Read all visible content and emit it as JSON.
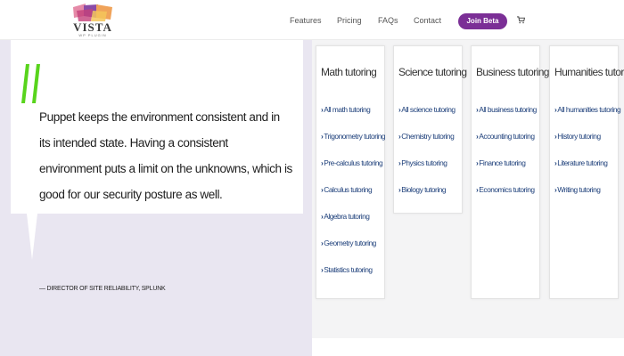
{
  "logo": {
    "word": "VISTA",
    "sub": "WP PLUGIN"
  },
  "nav": {
    "features": "Features",
    "pricing": "Pricing",
    "faqs": "FAQs",
    "contact": "Contact",
    "cta": "Join Beta",
    "cart_icon": "cart-icon"
  },
  "quote": {
    "text": "Puppet keeps the environment consistent and in its intended state. Having a consistent environment puts a limit on the unknowns, which is good for our security posture as well.",
    "author": "— DIRECTOR OF SITE RELIABILITY, SPLUNK"
  },
  "colors": {
    "accent": "#7b2f96",
    "quote_mark": "#58d41c",
    "link": "#1d3f7a",
    "panel": "#e9e6f1"
  },
  "cards": [
    {
      "title": "Math tutoring",
      "links": [
        "All math tutoring",
        "Trigonometry tutoring",
        "Pre-calculus tutoring",
        "Calculus tutoring",
        "Algebra tutoring",
        "Geometry tutoring",
        "Statistics tutoring"
      ]
    },
    {
      "title": "Science tutoring",
      "links": [
        "All science tutoring",
        "Chemistry tutoring",
        "Physics tutoring",
        "Biology tutoring"
      ]
    },
    {
      "title": "Business tutoring",
      "links": [
        "All business tutoring",
        "Accounting tutoring",
        "Finance tutoring",
        "Economics tutoring"
      ]
    },
    {
      "title": "Humanities tutoring",
      "links": [
        "All humanities tutoring",
        "History tutoring",
        "Literature tutoring",
        "Writing tutoring"
      ]
    }
  ]
}
